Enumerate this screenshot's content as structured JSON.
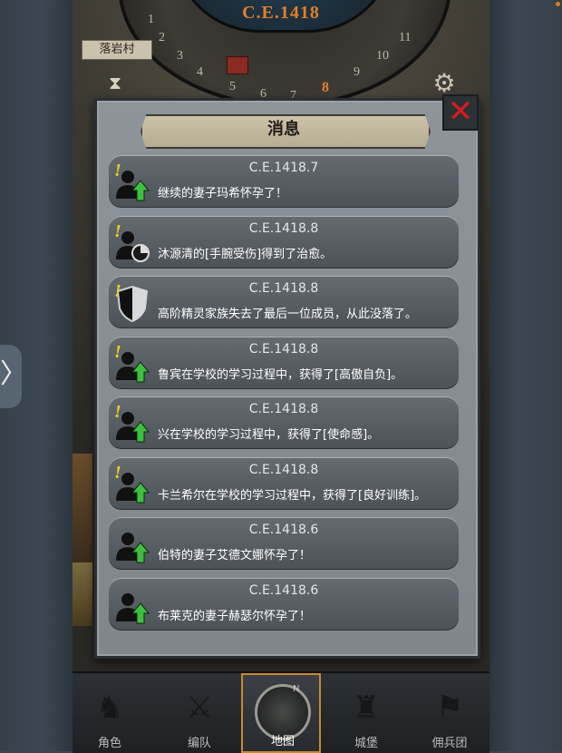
{
  "top": {
    "date": "C.E.1418",
    "village": "落岩村",
    "month_numbers": [
      "1",
      "2",
      "3",
      "4",
      "5",
      "6",
      "7",
      "8",
      "9",
      "10",
      "11"
    ],
    "current_month": "8"
  },
  "panel": {
    "title": "消息",
    "close_symbol": "✕"
  },
  "messages": [
    {
      "date": "C.E.1418.7",
      "text": "继续的妻子玛希怀孕了！",
      "icon": "person-up-icon",
      "alert": true
    },
    {
      "date": "C.E.1418.8",
      "text": "沐源清的[手腕受伤]得到了治愈。",
      "icon": "person-pie-icon",
      "alert": true
    },
    {
      "date": "C.E.1418.8",
      "text": "高阶精灵家族失去了最后一位成员，从此没落了。",
      "icon": "shield-icon",
      "alert": true
    },
    {
      "date": "C.E.1418.8",
      "text": "鲁宾在学校的学习过程中，获得了[高傲自负]。",
      "icon": "person-up-icon",
      "alert": true
    },
    {
      "date": "C.E.1418.8",
      "text": "兴在学校的学习过程中，获得了[使命感]。",
      "icon": "person-up-icon",
      "alert": true
    },
    {
      "date": "C.E.1418.8",
      "text": "卡兰希尔在学校的学习过程中，获得了[良好训练]。",
      "icon": "person-up-icon",
      "alert": true
    },
    {
      "date": "C.E.1418.6",
      "text": "伯特的妻子艾德文娜怀孕了！",
      "icon": "person-up-icon",
      "alert": false
    },
    {
      "date": "C.E.1418.6",
      "text": "布莱克的妻子赫瑟尔怀孕了！",
      "icon": "person-up-icon",
      "alert": false
    }
  ],
  "alert_mark": "!",
  "nav": {
    "items": [
      {
        "label": "角色",
        "icon": "knight-icon"
      },
      {
        "label": "编队",
        "icon": "squad-icon"
      },
      {
        "label": "地图",
        "icon": "compass-icon",
        "active": true,
        "north": "N"
      },
      {
        "label": "城堡",
        "icon": "castle-icon"
      },
      {
        "label": "佣兵团",
        "icon": "mercenary-icon"
      }
    ]
  },
  "side_arrow": "〉",
  "colors": {
    "accent_date": "#e0802a",
    "alert": "#f2d11c",
    "up_arrow": "#3fbf3f",
    "close": "#d71c1c",
    "nav_active_border": "#c98a2c"
  }
}
